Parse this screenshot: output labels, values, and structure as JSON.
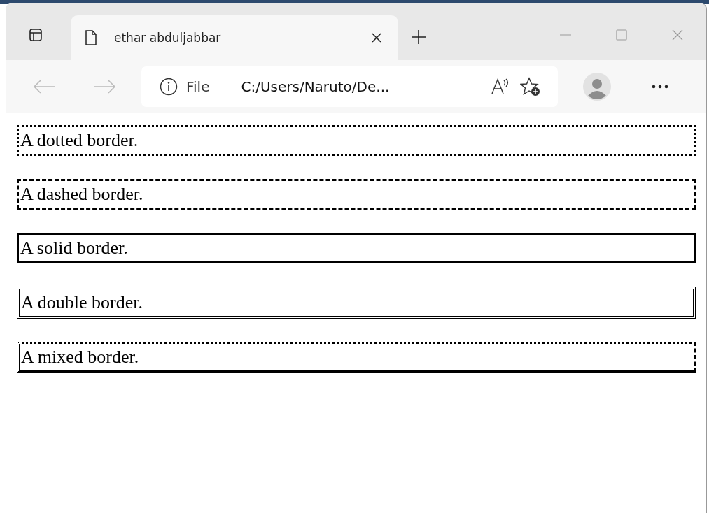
{
  "tab": {
    "title": "ethar abduljabbar",
    "selected": true
  },
  "address_bar": {
    "scheme": "File",
    "url": "C:/Users/Naruto/De..."
  },
  "paragraphs": [
    {
      "kind": "dotted",
      "text": "A dotted border."
    },
    {
      "kind": "dashed",
      "text": "A dashed border."
    },
    {
      "kind": "solid",
      "text": "A solid border."
    },
    {
      "kind": "double",
      "text": "A double border."
    },
    {
      "kind": "mixed",
      "text": "A mixed border."
    }
  ]
}
